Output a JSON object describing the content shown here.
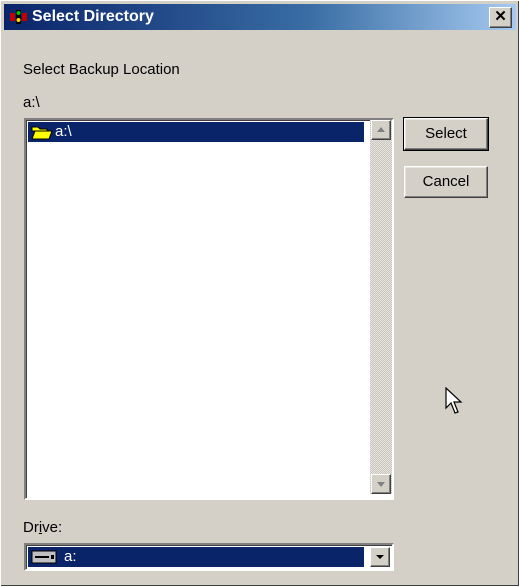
{
  "window": {
    "title": "Select Directory",
    "close_glyph": "✕"
  },
  "dialog": {
    "prompt": "Select Backup Location",
    "current_path": "a:\\",
    "directories": [
      {
        "label": "a:\\",
        "icon": "open-folder-icon"
      }
    ],
    "drive_label": "Drive:",
    "drive_value": "a:"
  },
  "buttons": {
    "select": "Select",
    "cancel": "Cancel"
  },
  "colors": {
    "selection": "#0a246a",
    "face": "#d4d0c8",
    "title_start": "#0a246a",
    "title_end": "#a6caf0"
  }
}
